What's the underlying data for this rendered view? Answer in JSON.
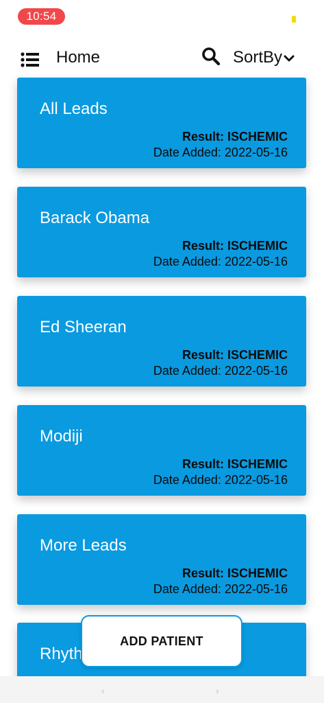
{
  "status_bar": {
    "time": "10:54",
    "time_pill_color": "#f2474a",
    "indicator_color": "#f5d90a"
  },
  "header": {
    "menu_icon": "list-icon",
    "title": "Home",
    "search_icon": "search-icon",
    "sort_label": "SortBy",
    "sort_icon": "chevron-down-icon"
  },
  "patients": [
    {
      "name": "All Leads",
      "result": "Result: ISCHEMIC",
      "date": "Date Added: 2022-05-16"
    },
    {
      "name": "Barack Obama",
      "result": "Result: ISCHEMIC",
      "date": "Date Added: 2022-05-16"
    },
    {
      "name": "Ed Sheeran",
      "result": "Result: ISCHEMIC",
      "date": "Date Added: 2022-05-16"
    },
    {
      "name": "Modiji",
      "result": "Result: ISCHEMIC",
      "date": "Date Added: 2022-05-16"
    },
    {
      "name": "More Leads",
      "result": "Result: ISCHEMIC",
      "date": "Date Added: 2022-05-16"
    },
    {
      "name": "Rhythm",
      "result": "",
      "date": ""
    }
  ],
  "add_button": {
    "label": "ADD PATIENT"
  },
  "nav_bar": {
    "back": "‹",
    "forward": "›"
  },
  "colors": {
    "card": "#0a9ae0",
    "card_text": "#ffffff",
    "meta_text": "#0b0b0b"
  }
}
